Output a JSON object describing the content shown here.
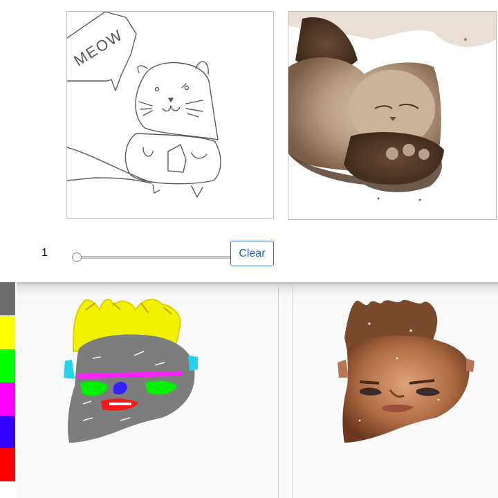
{
  "top_demo": {
    "sketch_text": "MEOW",
    "brush_size": "1",
    "clear_label": "Clear"
  },
  "bottom_demo": {
    "palette_colors": [
      "#6d6d6d",
      "#ffff00",
      "#00ff00",
      "#ff00ff",
      "#3300ff",
      "#ff0000"
    ]
  }
}
